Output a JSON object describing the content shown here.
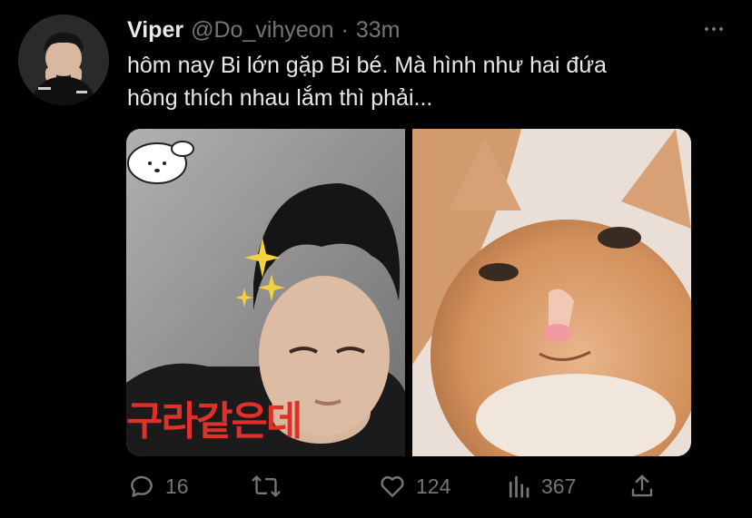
{
  "tweet": {
    "display_name": "Viper",
    "handle": "@Do_vihyeon",
    "separator": "·",
    "time": "33m",
    "text_lines": [
      "hôm nay Bi lớn gặp Bi bé. Mà hình như hai đứa",
      "hông thích nhau lắm thì phải..."
    ],
    "media_caption": "구라같은데"
  },
  "actions": {
    "replies": "16",
    "likes": "124",
    "views": "367"
  },
  "icons": {
    "more": "more-icon",
    "reply": "reply-icon",
    "retweet": "retweet-icon",
    "like": "heart-icon",
    "views": "analytics-icon",
    "share": "share-icon"
  },
  "colors": {
    "background": "#000000",
    "text": "#e7e9ea",
    "muted": "#71767b",
    "caption": "#e0302a"
  }
}
